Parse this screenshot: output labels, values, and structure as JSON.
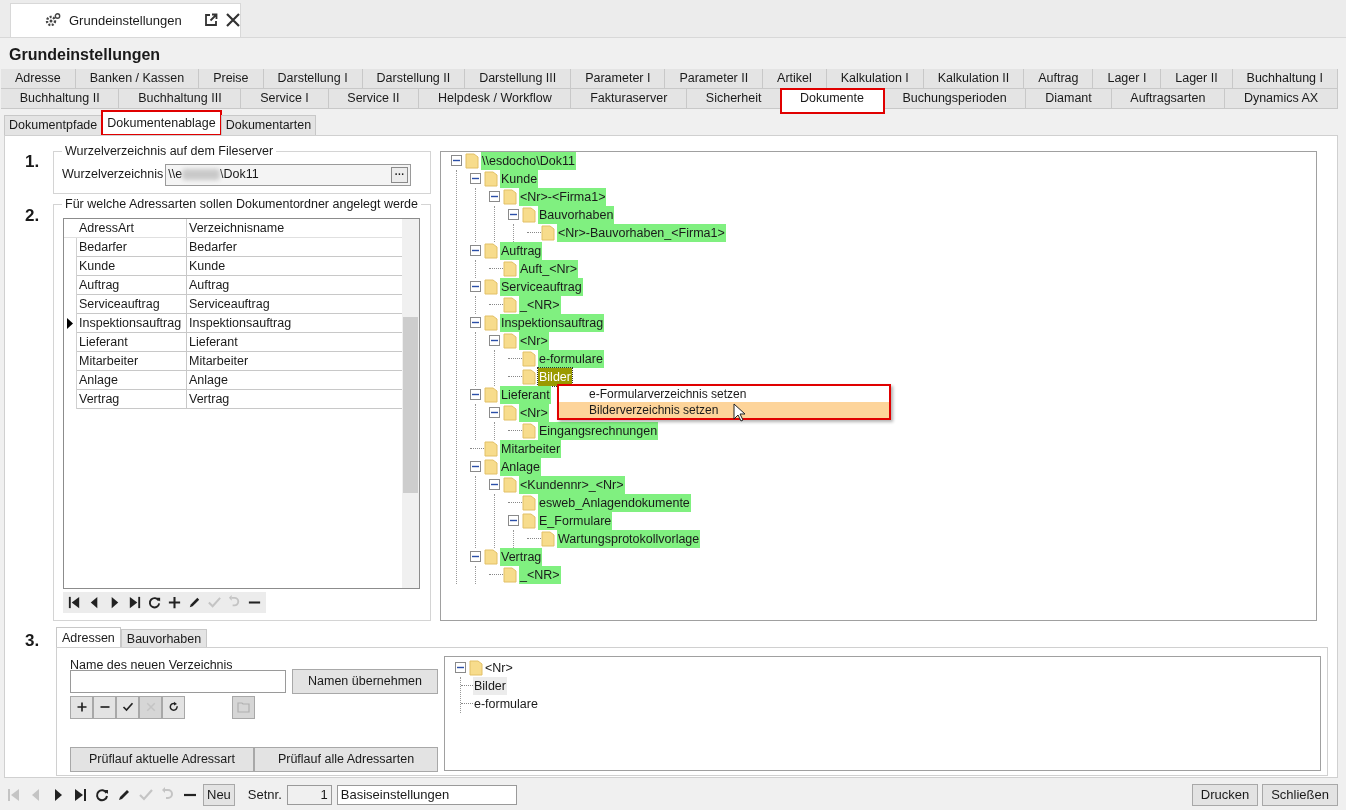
{
  "doc_tab": {
    "title": "Grundeinstellungen"
  },
  "title": "Grundeinstellungen",
  "tab_rows": [
    [
      {
        "label": "Adresse",
        "selected": false,
        "outlined": false
      },
      {
        "label": "Banken / Kassen",
        "selected": false,
        "outlined": false
      },
      {
        "label": "Preise",
        "selected": false,
        "outlined": false
      },
      {
        "label": "Darstellung I",
        "selected": false,
        "outlined": false
      },
      {
        "label": "Darstellung II",
        "selected": false,
        "outlined": false
      },
      {
        "label": "Darstellung III",
        "selected": false,
        "outlined": false
      },
      {
        "label": "Parameter I",
        "selected": false,
        "outlined": false
      },
      {
        "label": "Parameter II",
        "selected": false,
        "outlined": false
      },
      {
        "label": "Artikel",
        "selected": false,
        "outlined": false
      },
      {
        "label": "Kalkulation I",
        "selected": false,
        "outlined": false
      },
      {
        "label": "Kalkulation II",
        "selected": false,
        "outlined": false
      },
      {
        "label": "Auftrag",
        "selected": false,
        "outlined": false
      },
      {
        "label": "Lager I",
        "selected": false,
        "outlined": false
      },
      {
        "label": "Lager II",
        "selected": false,
        "outlined": false
      },
      {
        "label": "Buchhaltung I",
        "selected": false,
        "outlined": false
      }
    ],
    [
      {
        "label": "Buchhaltung II",
        "selected": false,
        "outlined": false
      },
      {
        "label": "Buchhaltung III",
        "selected": false,
        "outlined": false
      },
      {
        "label": "Service I",
        "selected": false,
        "outlined": false
      },
      {
        "label": "Service II",
        "selected": false,
        "outlined": false
      },
      {
        "label": "Helpdesk / Workflow",
        "selected": false,
        "outlined": false
      },
      {
        "label": "Fakturaserver",
        "selected": false,
        "outlined": false
      },
      {
        "label": "Sicherheit",
        "selected": false,
        "outlined": false
      },
      {
        "label": "Dokumente",
        "selected": true,
        "outlined": true
      },
      {
        "label": "Buchungsperioden",
        "selected": false,
        "outlined": false
      },
      {
        "label": "Diamant",
        "selected": false,
        "outlined": false
      },
      {
        "label": "Auftragsarten",
        "selected": false,
        "outlined": false
      },
      {
        "label": "Dynamics AX",
        "selected": false,
        "outlined": false
      }
    ]
  ],
  "subtabs": [
    {
      "label": "Dokumentpfade",
      "selected": false,
      "outlined": false
    },
    {
      "label": "Dokumentenablage",
      "selected": true,
      "outlined": true
    },
    {
      "label": "Dokumentarten",
      "selected": false,
      "outlined": false
    }
  ],
  "section1": {
    "number": "1.",
    "legend": "Wurzelverzeichnis auf dem Fileserver",
    "label": "Wurzelverzeichnis",
    "value_start": "\\\\e",
    "value_end": "\\Dok11",
    "browse": "···"
  },
  "section2": {
    "number": "2.",
    "legend": "Für welche Adressarten sollen Dokumentordner angelegt werde",
    "columns": [
      "AdressArt",
      "Verzeichnisname"
    ],
    "rows": [
      {
        "cells": [
          "Bedarfer",
          "Bedarfer"
        ],
        "current": false
      },
      {
        "cells": [
          "Kunde",
          "Kunde"
        ],
        "current": false
      },
      {
        "cells": [
          "Auftrag",
          "Auftrag"
        ],
        "current": false
      },
      {
        "cells": [
          "Serviceauftrag",
          "Serviceauftrag"
        ],
        "current": false
      },
      {
        "cells": [
          "Inspektionsauftrag",
          "Inspektionsauftrag"
        ],
        "current": true
      },
      {
        "cells": [
          "Lieferant",
          "Lieferant"
        ],
        "current": false
      },
      {
        "cells": [
          "Mitarbeiter",
          "Mitarbeiter"
        ],
        "current": false
      },
      {
        "cells": [
          "Anlage",
          "Anlage"
        ],
        "current": false
      },
      {
        "cells": [
          "Vertrag",
          "Vertrag"
        ],
        "current": false
      }
    ],
    "toolbar": [
      {
        "kind": "first",
        "disabled": false
      },
      {
        "kind": "prev",
        "disabled": false
      },
      {
        "kind": "next",
        "disabled": false
      },
      {
        "kind": "last",
        "disabled": false
      },
      {
        "kind": "refresh",
        "disabled": false
      },
      {
        "kind": "add",
        "disabled": false
      },
      {
        "kind": "edit",
        "disabled": false
      },
      {
        "kind": "confirm",
        "disabled": true
      },
      {
        "kind": "undo",
        "disabled": true
      },
      {
        "kind": "delete",
        "disabled": false
      }
    ]
  },
  "folder_tree": {
    "label": "\\\\esdocho\\Dok11",
    "expanded": true,
    "selected": false,
    "children": [
      {
        "label": "Kunde",
        "expanded": true,
        "selected": false,
        "children": [
          {
            "label": "<Nr>-<Firma1>",
            "expanded": true,
            "selected": false,
            "children": [
              {
                "label": "Bauvorhaben",
                "expanded": true,
                "selected": false,
                "children": [
                  {
                    "label": "<Nr>-Bauvorhaben_<Firma1>",
                    "selected": false
                  }
                ]
              }
            ]
          }
        ]
      },
      {
        "label": "Auftrag",
        "expanded": true,
        "selected": false,
        "children": [
          {
            "label": "Auft_<Nr>",
            "selected": false
          }
        ]
      },
      {
        "label": "Serviceauftrag",
        "expanded": true,
        "selected": false,
        "children": [
          {
            "label": "_<NR>",
            "selected": false
          }
        ]
      },
      {
        "label": "Inspektionsauftrag",
        "expanded": true,
        "selected": false,
        "children": [
          {
            "label": "<Nr>",
            "expanded": true,
            "selected": false,
            "children": [
              {
                "label": "e-formulare",
                "selected": false
              },
              {
                "label": "Bilder",
                "selected": true
              }
            ]
          }
        ]
      },
      {
        "label": "Lieferant",
        "expanded": true,
        "selected": false,
        "children": [
          {
            "label": "<Nr>",
            "expanded": true,
            "selected": false,
            "children": [
              {
                "label": "Eingangsrechnungen",
                "selected": false
              }
            ]
          }
        ]
      },
      {
        "label": "Mitarbeiter",
        "selected": false
      },
      {
        "label": "Anlage",
        "expanded": true,
        "selected": false,
        "children": [
          {
            "label": "<Kundennr>_<Nr>",
            "expanded": true,
            "selected": false,
            "children": [
              {
                "label": "esweb_Anlagendokumente",
                "selected": false
              },
              {
                "label": "E_Formulare",
                "expanded": true,
                "selected": false,
                "children": [
                  {
                    "label": "Wartungsprotokollvorlage",
                    "selected": false
                  }
                ]
              }
            ]
          }
        ]
      },
      {
        "label": "Vertrag",
        "expanded": true,
        "selected": false,
        "children": [
          {
            "label": "_<NR>",
            "selected": false
          }
        ]
      }
    ]
  },
  "context_menu": {
    "items": [
      {
        "label": "e-Formularverzeichnis setzen",
        "highlighted": false
      },
      {
        "label": "Bilderverzeichnis setzen",
        "highlighted": true
      }
    ]
  },
  "section3": {
    "number": "3.",
    "tabs": [
      {
        "label": "Adressen",
        "selected": true
      },
      {
        "label": "Bauvorhaben",
        "selected": false
      }
    ],
    "field_label": "Name des neuen Verzeichnis",
    "apply_button": "Namen übernehmen",
    "tools": [
      {
        "kind": "add",
        "disabled": false
      },
      {
        "kind": "delete",
        "disabled": false
      },
      {
        "kind": "confirm",
        "disabled": false
      },
      {
        "kind": "cancel",
        "disabled": true
      },
      {
        "kind": "redo",
        "disabled": false
      }
    ],
    "folder_button": {
      "disabled": true
    },
    "check_buttons": [
      "Prüflauf aktuelle Adressart",
      "Prüflauf alle Adressarten"
    ],
    "tree": {
      "label": "<Nr>",
      "expanded": true,
      "children": [
        {
          "label": "Bilder",
          "selected": true
        },
        {
          "label": "e-formulare",
          "selected": false
        }
      ]
    }
  },
  "status_bar": {
    "toolbar": [
      {
        "kind": "first",
        "disabled": true
      },
      {
        "kind": "prev",
        "disabled": true
      },
      {
        "kind": "next",
        "disabled": false
      },
      {
        "kind": "last",
        "disabled": false
      },
      {
        "kind": "refresh",
        "disabled": false
      },
      {
        "kind": "edit",
        "disabled": false
      },
      {
        "kind": "confirm",
        "disabled": true
      },
      {
        "kind": "undo",
        "disabled": true
      },
      {
        "kind": "delete",
        "disabled": false
      }
    ],
    "new_button": "Neu",
    "set_label": "Setnr.",
    "set_number": "1",
    "set_name": "Basiseinstellungen",
    "buttons": [
      "Drucken",
      "Schließen"
    ]
  }
}
